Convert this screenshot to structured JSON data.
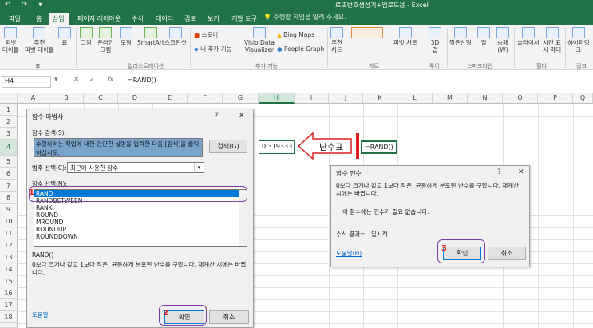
{
  "window": {
    "title": "로또번호생성기+업로드용 - Excel",
    "qat": "↶ ↷ ▾"
  },
  "ribbon": {
    "tabs": [
      "파일",
      "홈",
      "삽입",
      "페이지 레이아웃",
      "수식",
      "데이터",
      "검토",
      "보기",
      "개발 도구"
    ],
    "active_tab": "삽입",
    "tell_me": "수행할 작업을 알려 주세요.",
    "buttons": {
      "pivot": "피벗\n테이블",
      "rec_pivot": "추천\n피벗 테이블",
      "table": "표",
      "picture": "그림",
      "online_pic": "온라인\n그림",
      "shapes": "도형",
      "smartart": "SmartArt",
      "screenshot": "스크린샷",
      "store": "스토어",
      "my_addins": "내 추가 기능",
      "visio": "Visio Data\nVisualizer",
      "bing": "Bing Maps",
      "people": "People Graph",
      "rec_charts": "추천\n차트",
      "pivot_chart": "피벗 차트",
      "chart3d": "3D\n맵",
      "line": "꺾은선형",
      "column": "열",
      "winloss": "승패\n(W)",
      "slicer": "슬라이서",
      "timeline": "시간 표\n시 막대",
      "link": "하이퍼링\n크"
    },
    "groups": {
      "tables": "표",
      "illust": "일러스트레이션",
      "addins": "추가 기능",
      "charts": "차트",
      "tours": "투어",
      "spark": "스파크라인",
      "filters": "필터",
      "links": "링크"
    }
  },
  "formula_bar": {
    "name_box": "H4",
    "cancel": "✕",
    "enter": "✓",
    "fx": "fx",
    "formula": "=RAND()"
  },
  "sheet": {
    "columns": [
      "A",
      "B",
      "C",
      "D",
      "E",
      "F",
      "G",
      "H",
      "I",
      "J",
      "K",
      "L",
      "M",
      "N",
      "O",
      "P",
      "Q"
    ],
    "rows": [
      "1",
      "2",
      "3",
      "4",
      "5",
      "6",
      "7",
      "8",
      "9",
      "10",
      "11",
      "12",
      "13",
      "14",
      "15",
      "16",
      "17",
      "18",
      "19"
    ],
    "h4_value": "0.319333",
    "k4_value": "=RAND()",
    "arrow_label": "난수표"
  },
  "func_wizard": {
    "title": "함수 마법사",
    "help": "?",
    "close": "✕",
    "search_label": "함수 검색(S):",
    "search_text": "수행하려는 작업에 대한 간단한 설명을 입력한 다음 [검색]을 클릭하십시오.",
    "search_btn": "검색(G)",
    "category_label": "범주 선택(C):",
    "category_value": "최근에 사용한 함수",
    "select_label": "함수 선택(N):",
    "functions": [
      "RAND",
      "RANDBETWEEN",
      "RANK",
      "ROUND",
      "MROUND",
      "ROUNDUP",
      "ROUNDDOWN"
    ],
    "signature": "RAND()",
    "description": "0보다 크거나 같고 1보다 작은, 균등하게 분포된 난수를 구합니다. 재계산 시에는 바뀝니다.",
    "help_link": "도움말",
    "ok": "확인",
    "cancel": "취소"
  },
  "func_args": {
    "title": "함수 인수",
    "help": "?",
    "close": "✕",
    "description": "0보다 크거나 같고 1보다 작은, 균등하게 분포된 난수를 구합니다. 재계산 시에는 바뀝니다.",
    "no_args": "이 함수에는 인수가 필요 없습니다.",
    "result_label": "수식 결과=",
    "result_value": "일시적",
    "help_link": "도움말(H)",
    "ok": "확인",
    "cancel": "취소"
  },
  "annotations": [
    "1",
    "2",
    "3"
  ],
  "colors": {
    "accent": "#217346",
    "annotation": "#7b3fa1",
    "marker": "#e02020"
  }
}
